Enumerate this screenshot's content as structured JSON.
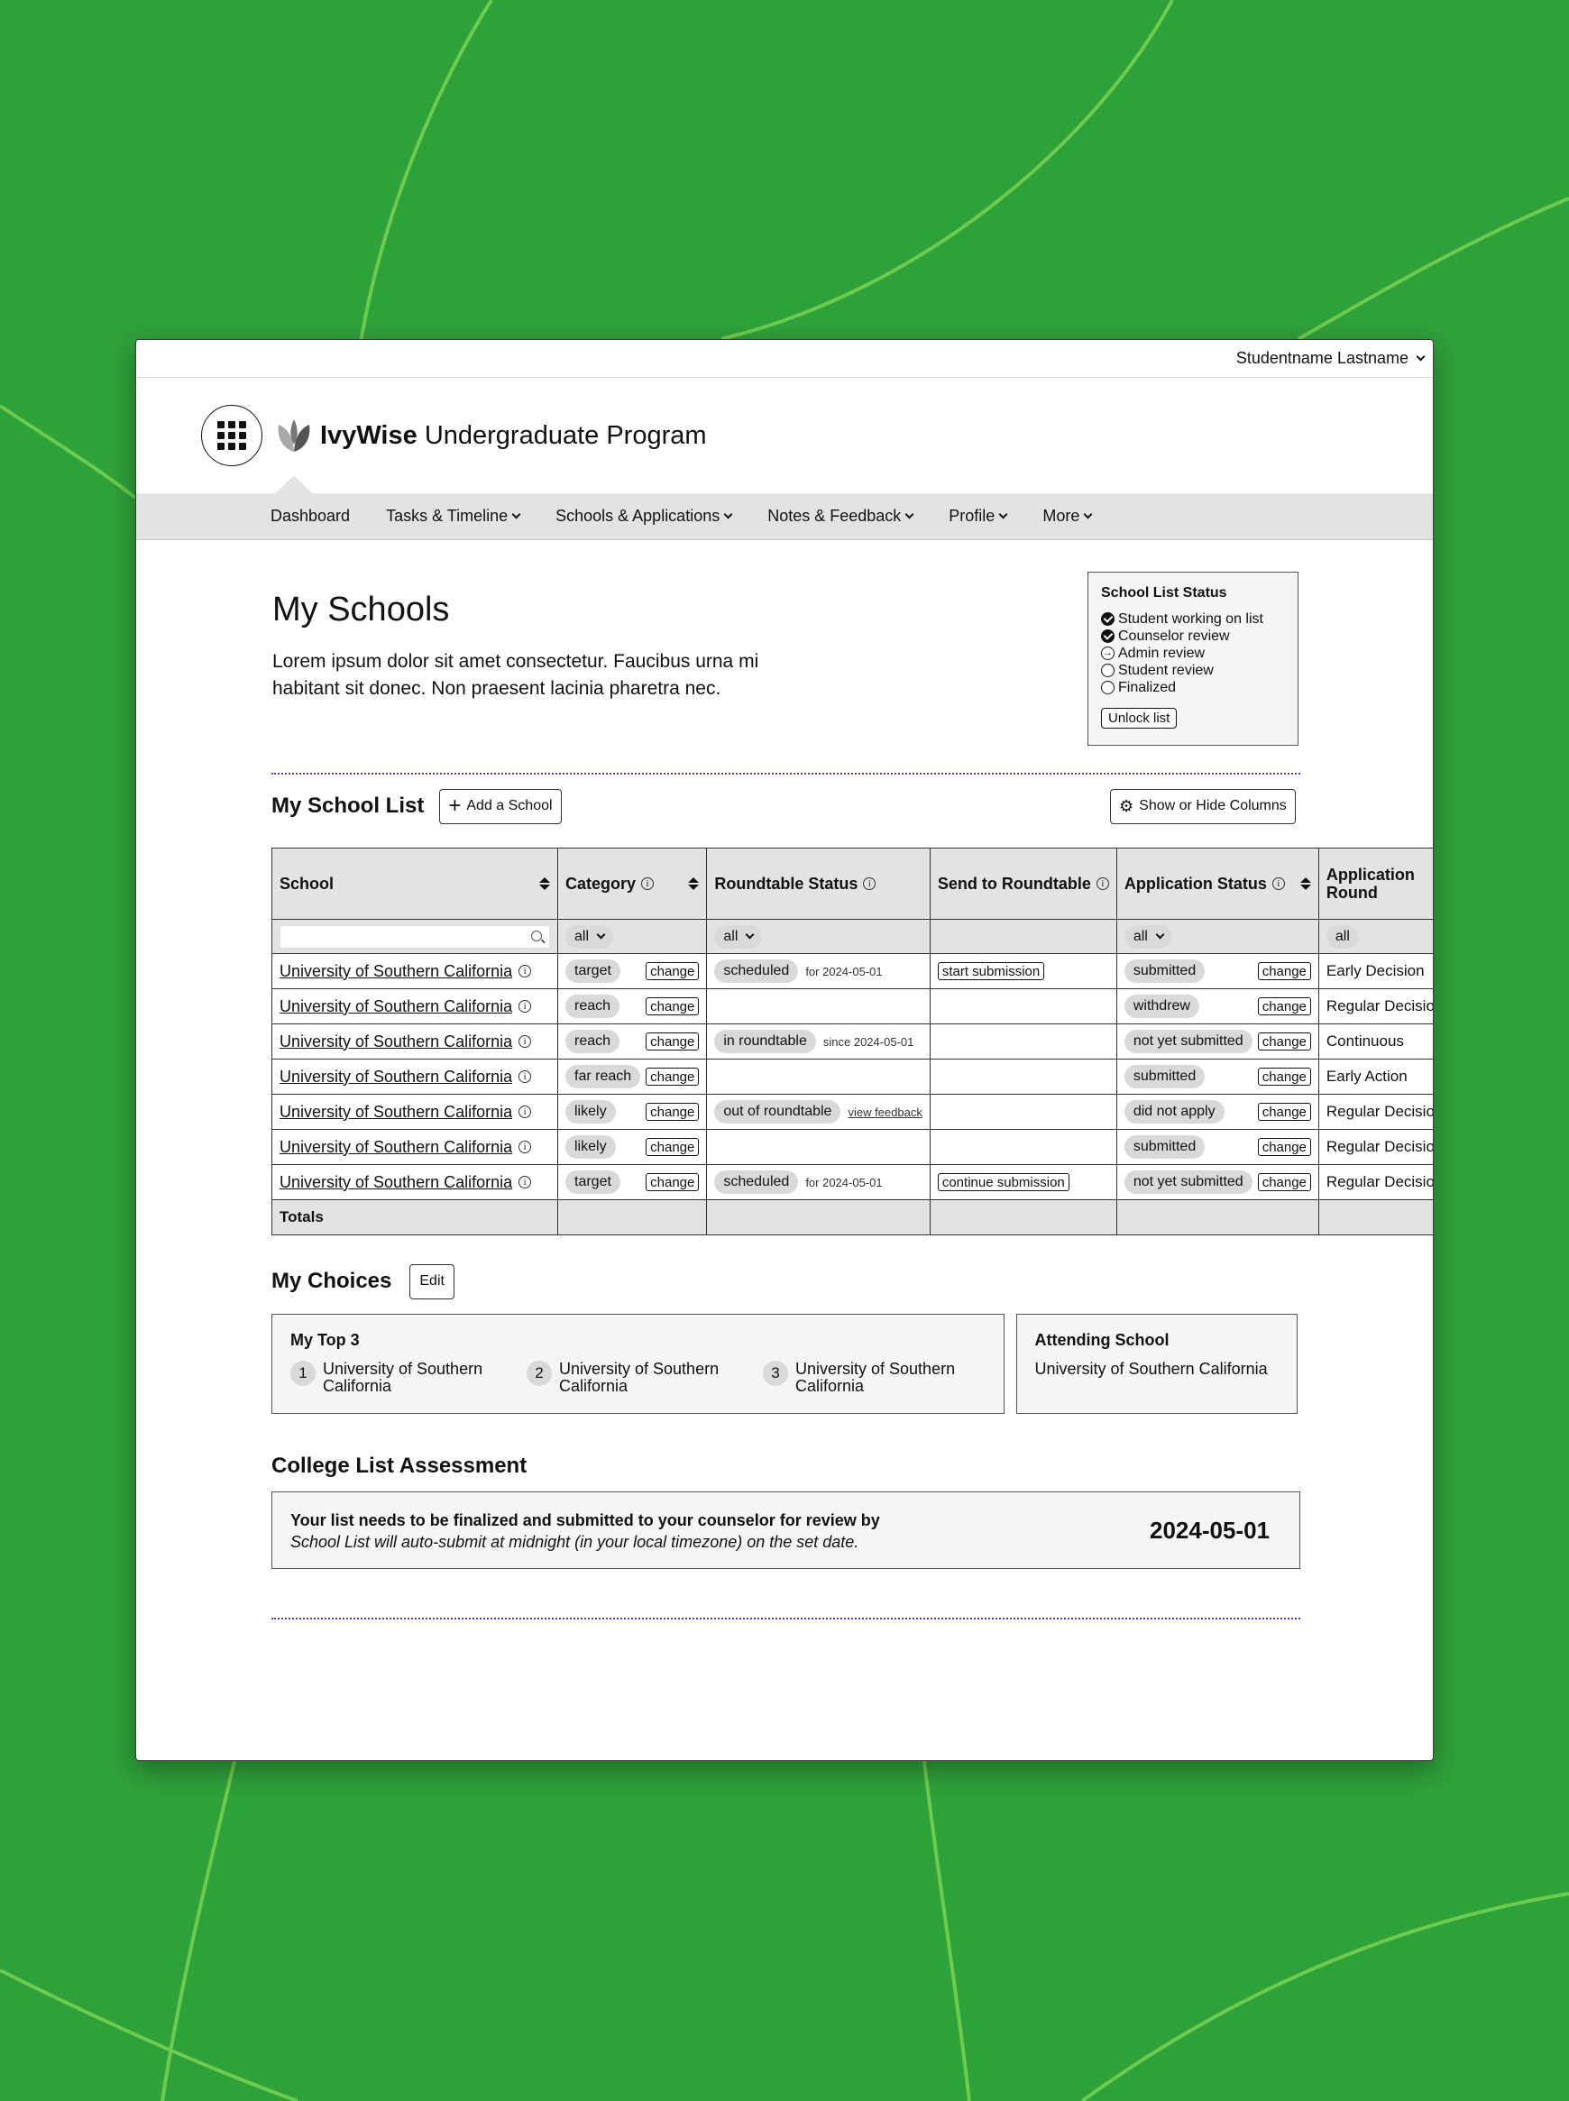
{
  "user": {
    "name": "Studentname Lastname"
  },
  "brand": {
    "bold": "IvyWise",
    "rest": "Undergraduate Program"
  },
  "nav": [
    {
      "label": "Dashboard",
      "dropdown": false
    },
    {
      "label": "Tasks & Timeline",
      "dropdown": true
    },
    {
      "label": "Schools & Applications",
      "dropdown": true
    },
    {
      "label": "Notes & Feedback",
      "dropdown": true
    },
    {
      "label": "Profile",
      "dropdown": true
    },
    {
      "label": "More",
      "dropdown": true
    }
  ],
  "page": {
    "title": "My Schools",
    "intro": "Lorem ipsum dolor sit amet consectetur. Faucibus urna mi habitant sit donec. Non praesent lacinia pharetra nec."
  },
  "status_box": {
    "title": "School List Status",
    "items": [
      {
        "label": "Student working on list",
        "state": "done"
      },
      {
        "label": "Counselor review",
        "state": "done"
      },
      {
        "label": "Admin review",
        "state": "current"
      },
      {
        "label": "Student review",
        "state": "pending"
      },
      {
        "label": "Finalized",
        "state": "pending"
      }
    ],
    "unlock_label": "Unlock list"
  },
  "school_list": {
    "title": "My School List",
    "add_label": "Add a School",
    "columns_label": "Show or Hide Columns",
    "headers": {
      "school": "School",
      "category": "Category",
      "roundtable": "Roundtable Status",
      "send": "Send to Roundtable",
      "application": "Application Status",
      "app_round": "Application Round"
    },
    "filters": {
      "category": "all",
      "roundtable": "all",
      "application": "all",
      "app_round": "all"
    },
    "change_label": "change",
    "rows": [
      {
        "school": "University of Southern California",
        "category": "target",
        "rt_status": "scheduled",
        "rt_note": "for 2024-05-01",
        "rt_link": "",
        "send": "start submission",
        "app_status": "submitted",
        "round": "Early Decision"
      },
      {
        "school": "University of Southern California",
        "category": "reach",
        "rt_status": "",
        "rt_note": "",
        "rt_link": "",
        "send": "",
        "app_status": "withdrew",
        "round": "Regular Decision"
      },
      {
        "school": "University of Southern California",
        "category": "reach",
        "rt_status": "in roundtable",
        "rt_note": "since 2024-05-01",
        "rt_link": "",
        "send": "",
        "app_status": "not yet submitted",
        "round": "Continuous"
      },
      {
        "school": "University of Southern California",
        "category": "far reach",
        "rt_status": "",
        "rt_note": "",
        "rt_link": "",
        "send": "",
        "app_status": "submitted",
        "round": "Early Action"
      },
      {
        "school": "University of Southern California",
        "category": "likely",
        "rt_status": "out of roundtable",
        "rt_note": "",
        "rt_link": "view feedback",
        "send": "",
        "app_status": "did not apply",
        "round": "Regular Decision"
      },
      {
        "school": "University of Southern California",
        "category": "likely",
        "rt_status": "",
        "rt_note": "",
        "rt_link": "",
        "send": "",
        "app_status": "submitted",
        "round": "Regular Decision"
      },
      {
        "school": "University of Southern California",
        "category": "target",
        "rt_status": "scheduled",
        "rt_note": "for 2024-05-01",
        "rt_link": "",
        "send": "continue submission",
        "app_status": "not yet submitted",
        "round": "Regular Decision"
      }
    ],
    "totals_label": "Totals"
  },
  "choices": {
    "title": "My Choices",
    "edit_label": "Edit",
    "top3_title": "My Top 3",
    "top3": [
      {
        "num": "1",
        "name": "University of Southern California"
      },
      {
        "num": "2",
        "name": "University of Southern California"
      },
      {
        "num": "3",
        "name": "University of Southern California"
      }
    ],
    "attending_title": "Attending School",
    "attending": "University of Southern California"
  },
  "assessment": {
    "title": "College List Assessment",
    "main": "Your list needs to be finalized and submitted to your counselor for review by",
    "sub": "School List will auto-submit at midnight (in your local timezone) on the set date.",
    "date": "2024-05-01"
  }
}
